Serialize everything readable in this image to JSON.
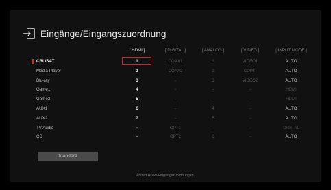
{
  "title": "Eingänge/Eingangszuordnung",
  "columns": [
    "[ HDMI ]",
    "[ DIGITAL ]",
    "[ ANALOG ]",
    "[ VIDEO ]",
    "[ INPUT MODE ]"
  ],
  "rows": [
    {
      "label": "CBL/SAT",
      "hdmi": "1",
      "digital": "COAX1",
      "analog": "1",
      "video": "VIDEO1",
      "mode": "AUTO"
    },
    {
      "label": "Media Player",
      "hdmi": "2",
      "digital": "COAX2",
      "analog": "2",
      "video": "COMP",
      "mode": "AUTO"
    },
    {
      "label": "Blu-ray",
      "hdmi": "3",
      "digital": "-",
      "analog": "3",
      "video": "VIDEO2",
      "mode": "AUTO"
    },
    {
      "label": "Game1",
      "hdmi": "4",
      "digital": "-",
      "analog": "-",
      "video": "-",
      "mode": "HDMI"
    },
    {
      "label": "Game2",
      "hdmi": "5",
      "digital": "-",
      "analog": "-",
      "video": "-",
      "mode": "HDMI"
    },
    {
      "label": "AUX1",
      "hdmi": "6",
      "digital": "-",
      "analog": "4",
      "video": "-",
      "mode": "AUTO"
    },
    {
      "label": "AUX2",
      "hdmi": "7",
      "digital": "-",
      "analog": "5",
      "video": "-",
      "mode": "AUTO"
    },
    {
      "label": "TV Audio",
      "hdmi": "-",
      "digital": "OPT1",
      "analog": "-",
      "video": "-",
      "mode": "DIGITAL"
    },
    {
      "label": "CD",
      "hdmi": "-",
      "digital": "OPT2",
      "analog": "6",
      "video": "-",
      "mode": "AUTO"
    }
  ],
  "dim_modes": [
    "HDMI",
    "DIGITAL"
  ],
  "selected_row": 0,
  "standard_button": "Standard",
  "status_text": "Ändert HDMI-Eingangszuordnungen.",
  "colors": {
    "accent": "#d12b2b",
    "background": "#111111"
  },
  "icons": {
    "title": "input-arrow-icon"
  }
}
